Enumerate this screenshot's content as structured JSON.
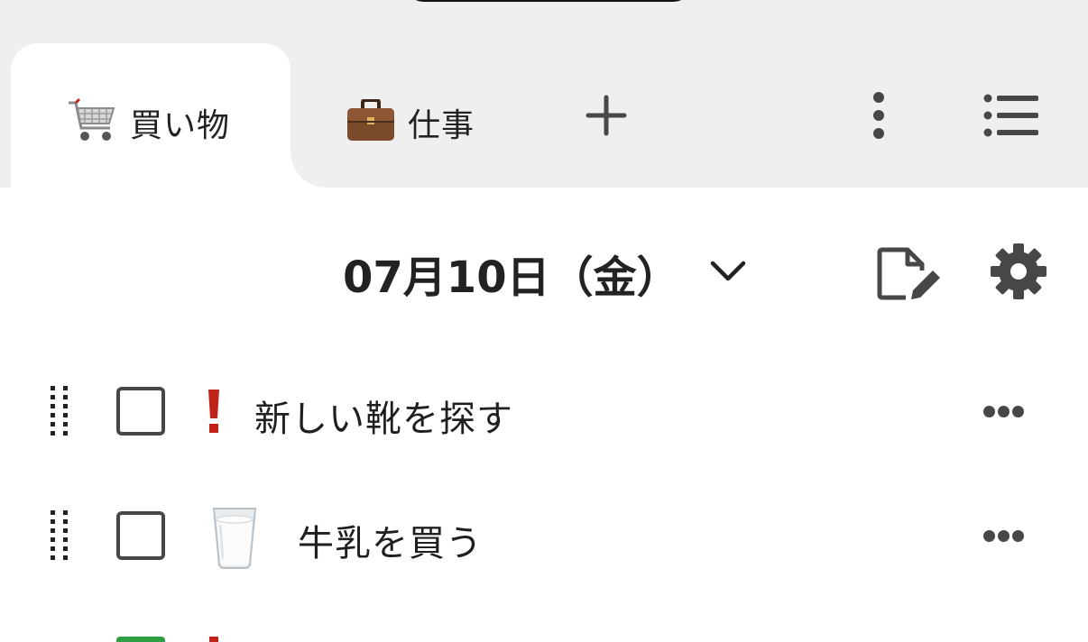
{
  "tabs": [
    {
      "icon": "shopping-cart-icon",
      "label": "買い物",
      "active": true
    },
    {
      "icon": "briefcase-icon",
      "label": "仕事",
      "active": false
    }
  ],
  "header": {
    "date": "07月10日（金）"
  },
  "tasks": [
    {
      "mark": "exclamation-icon",
      "label": "新しい靴を探す",
      "checked": false
    },
    {
      "mark": "milk-glass-icon",
      "label": "牛乳を買う",
      "checked": false
    }
  ],
  "colors": {
    "topbar": "#efefef",
    "icon": "#474747",
    "exclamation": "#c0231a",
    "partial_checkbox": "#2ea043"
  }
}
